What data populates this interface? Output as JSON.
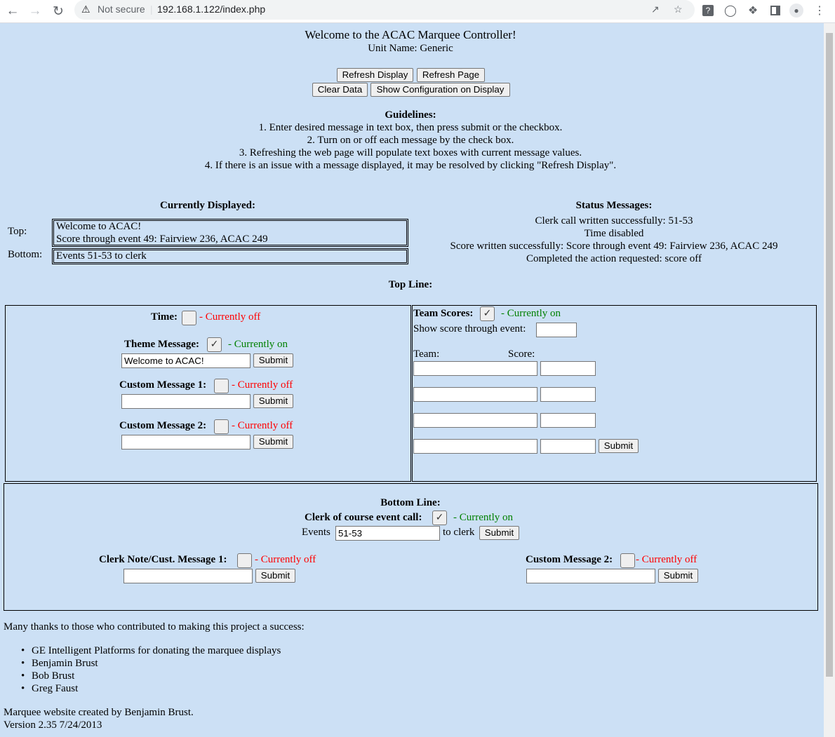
{
  "browser": {
    "security_label": "Not secure",
    "url": "192.168.1.122/index.php"
  },
  "header": {
    "title": "Welcome to the ACAC Marquee Controller!",
    "unit_name": "Unit Name: Generic"
  },
  "buttons": {
    "refresh_display": "Refresh Display",
    "refresh_page": "Refresh Page",
    "clear_data": "Clear Data",
    "show_config": "Show Configuration on Display",
    "submit": "Submit"
  },
  "guidelines": {
    "heading": "Guidelines:",
    "items": [
      "1. Enter desired message in text box, then press submit or the checkbox.",
      "2. Turn on or off each message by the check box.",
      "3. Refreshing the web page will populate text boxes with current message values.",
      "4. If there is an issue with a message displayed, it may be resolved by clicking \"Refresh Display\"."
    ]
  },
  "current": {
    "heading": "Currently Displayed:",
    "top_label": "Top:",
    "top_line1": "Welcome to ACAC!",
    "top_line2": "Score through event 49: Fairview 236, ACAC 249",
    "bottom_label": "Bottom:",
    "bottom_text": "Events 51-53 to clerk"
  },
  "status": {
    "heading": "Status Messages:",
    "items": [
      "Clerk call written successfully: 51-53",
      "Time disabled",
      "Score written successfully: Score through event 49: Fairview 236, ACAC 249",
      "Completed the action requested: score off"
    ]
  },
  "top_line": {
    "heading": "Top Line:",
    "time_label": "Time:",
    "theme_label": "Theme Message:",
    "theme_value": "Welcome to ACAC!",
    "custom1_label": "Custom Message 1:",
    "custom2_label": "Custom Message 2:",
    "team_scores_label": "Team Scores:",
    "show_score_label": "Show score through event:",
    "team_header": "Team:",
    "score_header": "Score:"
  },
  "states": {
    "off": "- Currently off",
    "on": "- Currently on",
    "off_tight": "- Currently off",
    "check": "✓"
  },
  "bottom_line": {
    "heading": "Bottom Line:",
    "clerk_label": "Clerk of course event call:",
    "events_label": "Events",
    "events_value": "51-53",
    "to_clerk": "to clerk",
    "note_label": "Clerk Note/Cust. Message 1:",
    "custom2_label": "Custom Message 2:"
  },
  "footer": {
    "thanks": "Many thanks to those who contributed to making this project a success:",
    "contributors": [
      "GE Intelligent Platforms for donating the marquee displays",
      "Benjamin Brust",
      "Bob Brust",
      "Greg Faust"
    ],
    "credit": "Marquee website created by Benjamin Brust.",
    "version": "Version 2.35 7/24/2013"
  }
}
